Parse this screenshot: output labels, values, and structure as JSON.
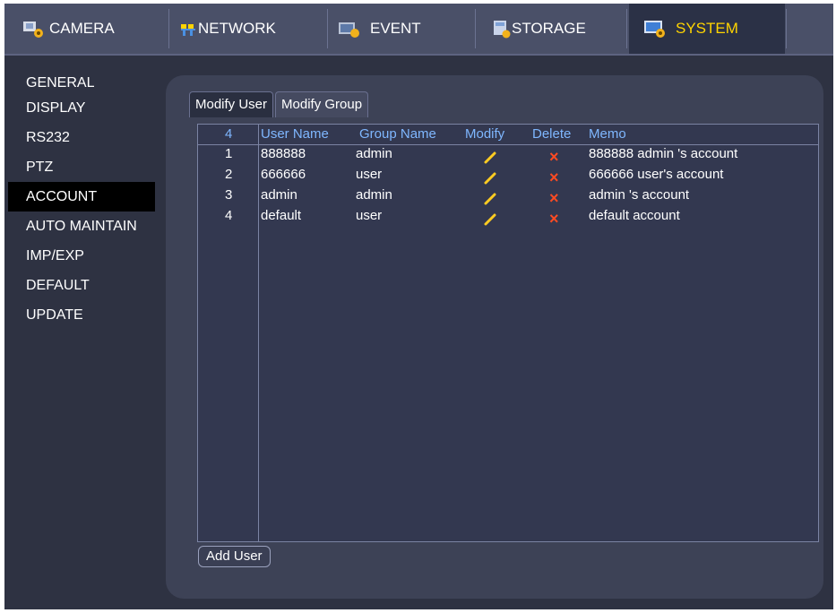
{
  "topbar": {
    "tabs": [
      {
        "label": "CAMERA",
        "icon": "camera-icon"
      },
      {
        "label": "NETWORK",
        "icon": "network-icon"
      },
      {
        "label": "EVENT",
        "icon": "event-icon"
      },
      {
        "label": "STORAGE",
        "icon": "storage-icon"
      },
      {
        "label": "SYSTEM",
        "icon": "system-icon",
        "active": true
      }
    ]
  },
  "sidebar": {
    "items": [
      {
        "label": "GENERAL"
      },
      {
        "label": "DISPLAY"
      },
      {
        "label": "RS232"
      },
      {
        "label": "PTZ"
      },
      {
        "label": "ACCOUNT",
        "active": true
      },
      {
        "label": "AUTO MAINTAIN"
      },
      {
        "label": "IMP/EXP"
      },
      {
        "label": "DEFAULT"
      },
      {
        "label": "UPDATE"
      }
    ]
  },
  "main": {
    "subtabs": [
      {
        "label": "Modify User",
        "active": true
      },
      {
        "label": "Modify Group"
      }
    ],
    "table": {
      "count": "4",
      "headers": {
        "user": "User Name",
        "group": "Group Name",
        "modify": "Modify",
        "delete": "Delete",
        "memo": "Memo"
      },
      "rows": [
        {
          "idx": "1",
          "user": "888888",
          "group": "admin",
          "memo": "888888 admin 's account"
        },
        {
          "idx": "2",
          "user": "666666",
          "group": "user",
          "memo": "666666 user's account"
        },
        {
          "idx": "3",
          "user": "admin",
          "group": "admin",
          "memo": "admin 's account"
        },
        {
          "idx": "4",
          "user": "default",
          "group": "user",
          "memo": "default account"
        }
      ]
    },
    "add_user_label": "Add User",
    "delete_glyph": "×"
  },
  "colors": {
    "active_tab_text": "#ffd400",
    "header_text": "#7fb7ff",
    "delete_icon": "#ff4b22",
    "edit_icon": "#ffcc22"
  }
}
